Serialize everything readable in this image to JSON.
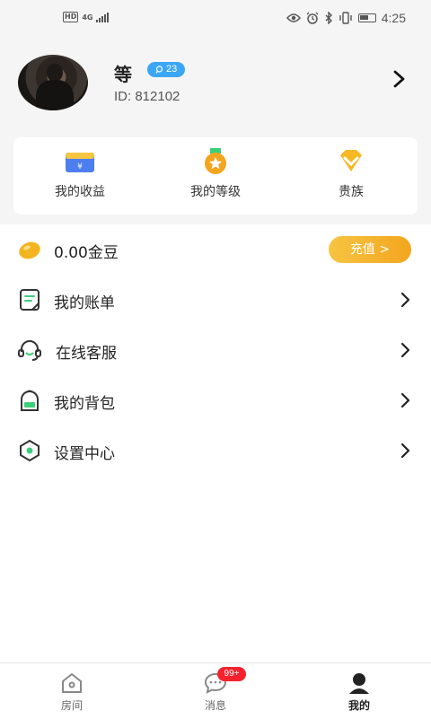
{
  "status_bar": {
    "network_badge": "HD",
    "network_type": "4G",
    "time": "4:25",
    "icons": [
      "eye-icon",
      "alarm-icon",
      "bluetooth-icon",
      "vibrate-icon",
      "battery-icon"
    ]
  },
  "profile": {
    "name": "等",
    "level": "23",
    "id_text": "ID: 812102"
  },
  "quick_actions": [
    {
      "label": "我的收益",
      "icon": "wallet-icon"
    },
    {
      "label": "我的等级",
      "icon": "medal-icon"
    },
    {
      "label": "贵族",
      "icon": "diamond-icon"
    }
  ],
  "balance": {
    "text": "0.00金豆",
    "button": "充值 >"
  },
  "menu": [
    {
      "label": "我的账单",
      "icon": "bill-icon"
    },
    {
      "label": "在线客服",
      "icon": "headset-icon"
    },
    {
      "label": "我的背包",
      "icon": "backpack-icon"
    },
    {
      "label": "设置中心",
      "icon": "settings-icon"
    }
  ],
  "tabbar": [
    {
      "label": "房间",
      "icon": "home-icon"
    },
    {
      "label": "消息",
      "icon": "chat-icon",
      "badge": "99+"
    },
    {
      "label": "我的",
      "icon": "user-icon"
    }
  ],
  "colors": {
    "accent_blue": "#3ba6f5",
    "recharge_gold": "#f3a51f",
    "badge_red": "#f5222d"
  }
}
